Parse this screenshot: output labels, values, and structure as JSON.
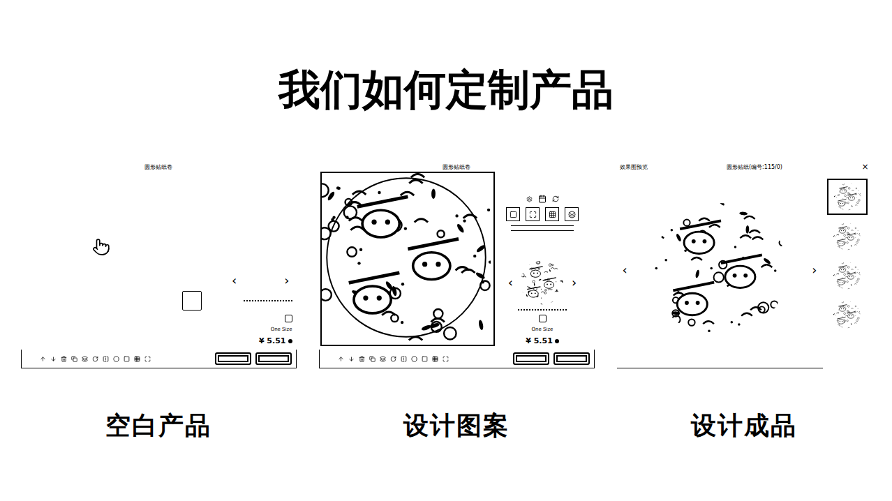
{
  "title": "我们如何定制产品",
  "panels": [
    {
      "kind": "blank",
      "header": "圆形贴纸卷",
      "caption": "空白产品",
      "size": "One Size",
      "price": "¥ 5.51",
      "prev": "‹",
      "next": "›"
    },
    {
      "kind": "design",
      "header": "圆形贴纸卷",
      "caption": "设计图案",
      "size": "One Size",
      "price": "¥ 5.51",
      "prev": "‹",
      "next": "›"
    },
    {
      "kind": "preview",
      "left": "效果图预览",
      "header": "圆形贴纸(编号:115/0)",
      "close": "×",
      "caption": "设计成品",
      "prev": "‹",
      "next": "›"
    }
  ]
}
